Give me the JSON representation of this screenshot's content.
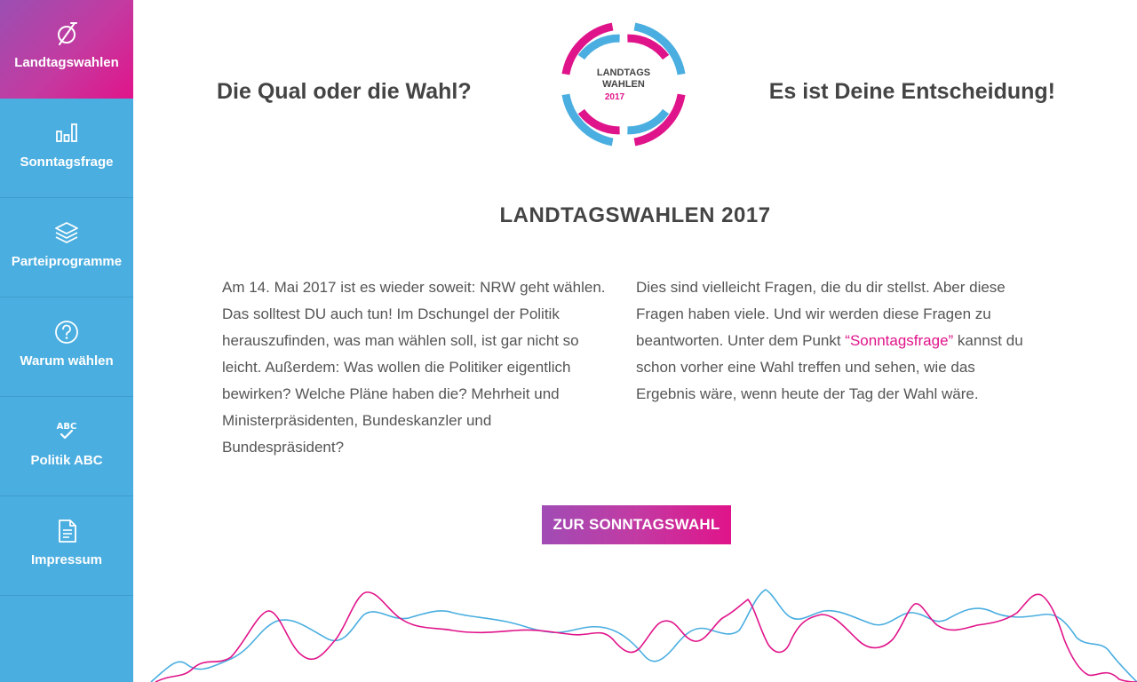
{
  "sidebar": {
    "items": [
      {
        "label": "Landtagswahlen",
        "icon": "ballot-icon",
        "active": true
      },
      {
        "label": "Sonntagsfrage",
        "icon": "bar-chart-icon",
        "active": false
      },
      {
        "label": "Parteiprogramme",
        "icon": "layers-icon",
        "active": false
      },
      {
        "label": "Warum wählen",
        "icon": "question-icon",
        "active": false
      },
      {
        "label": "Politik ABC",
        "icon": "abc-check-icon",
        "active": false
      },
      {
        "label": "Impressum",
        "icon": "document-icon",
        "active": false
      }
    ]
  },
  "header": {
    "left_headline": "Die Qual oder die Wahl?",
    "right_headline": "Es ist Deine Entscheidung!",
    "logo": {
      "line1": "LANDTAGS",
      "line2": "WAHLEN",
      "year": "2017"
    }
  },
  "main": {
    "title": "LANDTAGSWAHLEN 2017",
    "left_paragraph": "Am 14. Mai 2017 ist es wieder soweit: NRW geht wählen. Das solltest DU auch tun! Im Dschungel der Politik herauszufinden, was man wählen soll, ist gar nicht so leicht. Außerdem: Was wollen die Politiker eigentlich bewirken? Welche Pläne haben die? Mehrheit und Ministerpräsidenten, Bundeskanzler und Bundespräsident?",
    "right_paragraph_before": "Dies sind vielleicht Fragen, die du dir stellst. Aber diese Fragen haben viele. Und wir werden diese Fragen zu beantworten. Unter dem Punkt ",
    "right_paragraph_link": "“Sonntagsfrage”",
    "right_paragraph_after": " kannst du schon vorher eine Wahl treffen und sehen, wie das Ergebnis wäre, wenn heute der Tag der Wahl wäre.",
    "cta_label": "ZUR SONNTAGSWAHL"
  },
  "colors": {
    "blue": "#4aaee0",
    "magenta": "#e0148a",
    "purple": "#9b4fb2",
    "text": "#555555"
  }
}
